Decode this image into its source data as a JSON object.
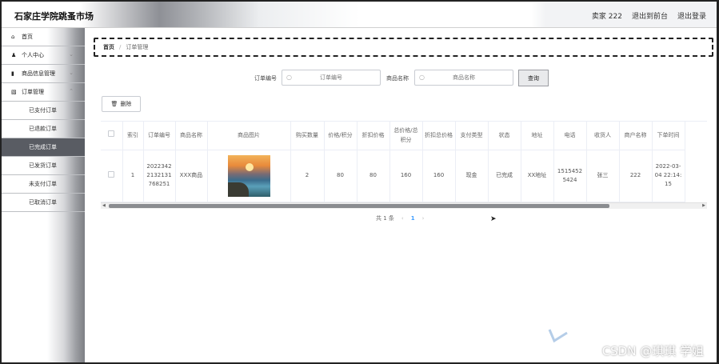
{
  "app": {
    "title": "石家庄学院跳蚤市场"
  },
  "topbar": {
    "user": "卖家 222",
    "back_label": "退出到前台",
    "logout_label": "退出登录"
  },
  "sidebar": {
    "items": [
      {
        "label": "首页",
        "icon": "home-icon"
      },
      {
        "label": "个人中心",
        "icon": "user-icon"
      },
      {
        "label": "商品信息管理",
        "icon": "bar-chart-icon"
      },
      {
        "label": "订单管理",
        "icon": "list-icon"
      }
    ],
    "sub_items": [
      {
        "label": "已支付订单"
      },
      {
        "label": "已退款订单"
      },
      {
        "label": "已完成订单",
        "active": true
      },
      {
        "label": "已发货订单"
      },
      {
        "label": "未支付订单"
      },
      {
        "label": "已取消订单"
      }
    ]
  },
  "breadcrumb": {
    "home": "首页",
    "sep": "/",
    "current": "订单管理"
  },
  "search": {
    "order_label": "订单编号",
    "order_placeholder": "订单编号",
    "product_label": "商品名称",
    "product_placeholder": "商品名称",
    "query_label": "查询"
  },
  "toolbar": {
    "delete_label": "删除"
  },
  "table": {
    "headers": [
      "",
      "索引",
      "订单编号",
      "商品名称",
      "商品图片",
      "购买数量",
      "价格/积分",
      "折扣价格",
      "总价格/总积分",
      "折扣总价格",
      "支付类型",
      "状态",
      "地址",
      "电话",
      "收货人",
      "商户名称",
      "下单时间"
    ],
    "rows": [
      {
        "index": "1",
        "order_no": "20223422132131768251",
        "product": "XXX商品",
        "quantity": "2",
        "price": "80",
        "discount_price": "80",
        "total": "160",
        "discount_total": "160",
        "pay_type": "现金",
        "status": "已完成",
        "address": "XX地址",
        "phone": "15154525424",
        "receiver": "张三",
        "merchant": "222",
        "time": "2022-03-04 22:14:15"
      }
    ]
  },
  "pager": {
    "total": "共 1 条",
    "prev": "‹",
    "page": "1",
    "next": "›"
  },
  "watermark": "CSDN @琪琪 学姐",
  "colors": {
    "active_sidebar": "#595c63",
    "accent": "#409eff"
  }
}
